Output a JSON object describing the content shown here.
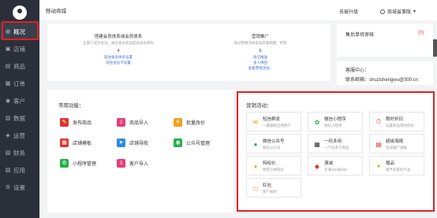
{
  "app": {
    "title": "移动商城"
  },
  "header": {
    "upgrade": "去被升级",
    "merchant": "商城省事版"
  },
  "sidebar": {
    "items": [
      {
        "label": "概况",
        "icon": "dashboard-icon"
      },
      {
        "label": "店铺",
        "icon": "shop-icon"
      },
      {
        "label": "商品",
        "icon": "goods-icon"
      },
      {
        "label": "订单",
        "icon": "order-icon"
      },
      {
        "label": "客户",
        "icon": "customer-icon"
      },
      {
        "label": "数据",
        "icon": "data-icon"
      },
      {
        "label": "运营",
        "icon": "operation-icon"
      },
      {
        "label": "财务",
        "icon": "finance-icon"
      },
      {
        "label": "应用",
        "icon": "app-icon"
      },
      {
        "label": "设置",
        "icon": "settings-icon"
      }
    ]
  },
  "overview": {
    "left": {
      "title": "搭建会员体系或会员体系",
      "sub": "让客户成为会员，通过会员权益提高会员转化",
      "num": "4",
      "link1": "前往会员体系设置",
      "link2": "前往会员卡设置"
    },
    "right": {
      "title": "营销推广",
      "sub": "通过营销活动提高店铺销量、积客",
      "num": "5",
      "link1": "短信推送",
      "link2": "多人拼团",
      "link3": "查看营销活动..."
    }
  },
  "right_panel": {
    "pending": "售后单待审核",
    "pending_count": "(0)",
    "store_center": "客服中心：",
    "email_label": "联系邮箱：shuzishengwu@300.cn"
  },
  "common": {
    "title": "常用功能：",
    "items": [
      {
        "label": "发布商品",
        "color": "#e0322d"
      },
      {
        "label": "商品导入",
        "color": "#e0407a"
      },
      {
        "label": "批量改价",
        "color": "#f0a020"
      },
      {
        "label": "店铺模板",
        "color": "#e0322d"
      },
      {
        "label": "店铺导航",
        "color": "#2a8be0"
      },
      {
        "label": "公众号管理",
        "color": "#25b04a"
      },
      {
        "label": "小程序管理",
        "color": "#25b04a"
      },
      {
        "label": "客户导入",
        "color": "#e0407a"
      }
    ]
  },
  "marketing": {
    "title": "营销活动：",
    "items": [
      {
        "title": "短信群发",
        "desc": "一键通知全网用户",
        "icon": "message-icon",
        "color": "#f0a020"
      },
      {
        "title": "微信小程序",
        "desc": "微信小程序",
        "icon": "miniprogram-icon",
        "color": "#25b04a"
      },
      {
        "title": "限时折扣",
        "desc": "设置商品限时折扣",
        "icon": "discount-icon",
        "color": "#e0322d"
      },
      {
        "title": "微信公众号",
        "desc": "微信公众号",
        "icon": "wechat-icon",
        "color": "#25b04a"
      },
      {
        "title": "一码多用",
        "desc": "一个码多个商品",
        "icon": "qrcode-icon",
        "color": "#333333"
      },
      {
        "title": "超级海报",
        "desc": "生成推广海报",
        "icon": "poster-icon",
        "color": "#e0322d"
      },
      {
        "title": "特权价",
        "desc": "特定价格购买",
        "icon": "vip-icon",
        "color": "#f0a020"
      },
      {
        "title": "满减",
        "desc": "买满400减200",
        "icon": "fullcut-icon",
        "color": "#e0322d"
      },
      {
        "title": "赠品",
        "desc": "赠予买家的产品",
        "icon": "gift-icon",
        "color": "#f0a020"
      },
      {
        "title": "红包",
        "desc": "客户福利",
        "icon": "redpacket-icon",
        "color": "#f0a020"
      }
    ]
  }
}
